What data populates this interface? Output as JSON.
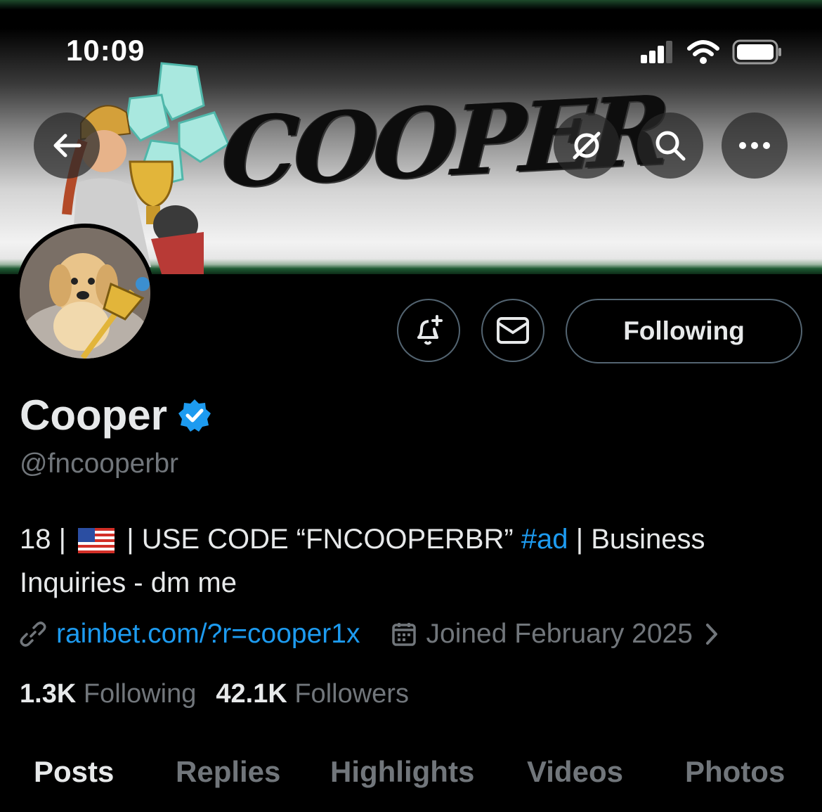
{
  "status_bar": {
    "time": "10:09"
  },
  "banner": {
    "title": "COOPER"
  },
  "profile": {
    "display_name": "Cooper",
    "handle": "@fncooperbr",
    "bio": {
      "prefix": "18 |",
      "flag_icon": "us-flag-icon",
      "middle": "| USE CODE “FNCOOPERBR”",
      "hashtag": "#ad",
      "suffix": "| Business Inquiries - dm me"
    },
    "link": "rainbet.com/?r=cooper1x",
    "joined": "Joined February 2025",
    "following_count": "1.3K",
    "following_label": "Following",
    "followers_count": "42.1K",
    "followers_label": "Followers"
  },
  "actions": {
    "following_button": "Following"
  },
  "tabs": [
    {
      "label": "Posts",
      "active": true
    },
    {
      "label": "Replies"
    },
    {
      "label": "Highlights"
    },
    {
      "label": "Videos"
    },
    {
      "label": "Photos"
    }
  ],
  "colors": {
    "accent": "#1d9bf0",
    "muted": "#71767b",
    "text": "#e7e9ea",
    "verified": "#1d9bf0"
  }
}
